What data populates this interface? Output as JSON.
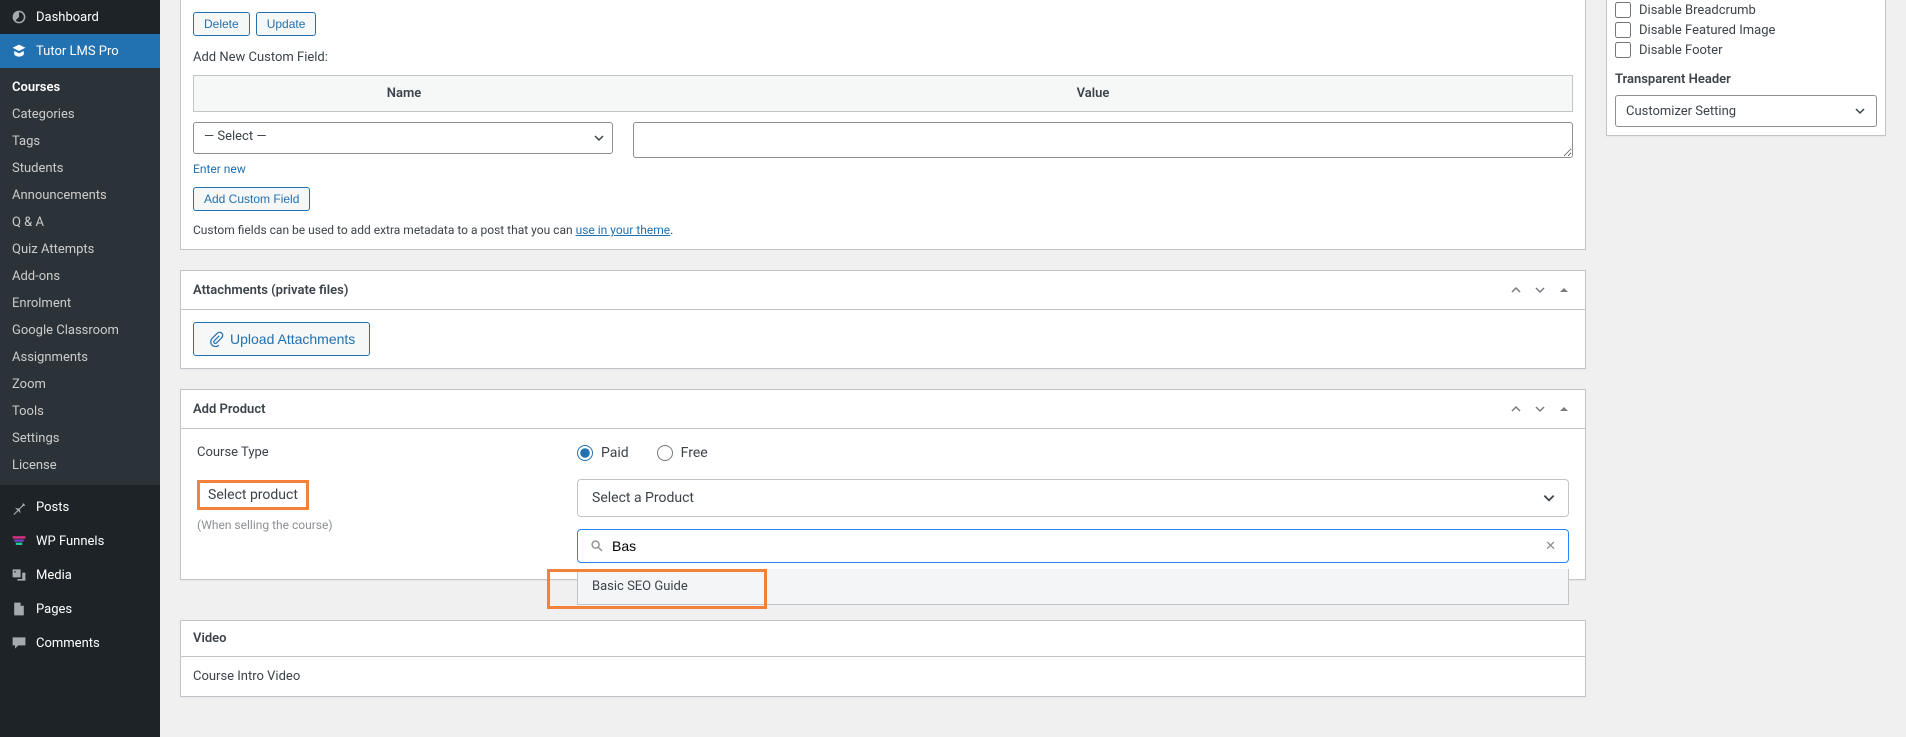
{
  "sidebar": {
    "top": [
      {
        "label": "Dashboard",
        "icon": "dashboard"
      },
      {
        "label": "Tutor LMS Pro",
        "icon": "tutor",
        "active": true
      }
    ],
    "sub": [
      {
        "label": "Courses",
        "current": true
      },
      {
        "label": "Categories"
      },
      {
        "label": "Tags"
      },
      {
        "label": "Students"
      },
      {
        "label": "Announcements"
      },
      {
        "label": "Q & A"
      },
      {
        "label": "Quiz Attempts"
      },
      {
        "label": "Add-ons"
      },
      {
        "label": "Enrolment"
      },
      {
        "label": "Google Classroom"
      },
      {
        "label": "Assignments"
      },
      {
        "label": "Zoom"
      },
      {
        "label": "Tools"
      },
      {
        "label": "Settings"
      },
      {
        "label": "License"
      }
    ],
    "bottom": [
      {
        "label": "Posts",
        "icon": "pin"
      },
      {
        "label": "WP Funnels",
        "icon": "funnel"
      },
      {
        "label": "Media",
        "icon": "media"
      },
      {
        "label": "Pages",
        "icon": "pages"
      },
      {
        "label": "Comments",
        "icon": "comments"
      }
    ]
  },
  "customFields": {
    "delete": "Delete",
    "update": "Update",
    "addNewLabel": "Add New Custom Field:",
    "nameHeader": "Name",
    "valueHeader": "Value",
    "selectPlaceholder": "— Select —",
    "enterNew": "Enter new",
    "addButton": "Add Custom Field",
    "footPrefix": "Custom fields can be used to add extra metadata to a post that you can ",
    "footLink": "use in your theme",
    "footSuffix": "."
  },
  "attachments": {
    "title": "Attachments (private files)",
    "upload": "Upload Attachments"
  },
  "addProduct": {
    "title": "Add Product",
    "courseTypeLabel": "Course Type",
    "paid": "Paid",
    "free": "Free",
    "selectProductHL": "Select product",
    "hint": "(When selling the course)",
    "selectPlaceholder": "Select a Product",
    "searchValue": "Bas",
    "resultItem": "Basic SEO Guide"
  },
  "video": {
    "title": "Video",
    "introLabel": "Course Intro Video"
  },
  "sidebox": {
    "disableBreadcrumb": "Disable Breadcrumb",
    "disableFeatured": "Disable Featured Image",
    "disableFooter": "Disable Footer",
    "transparentHeader": "Transparent Header",
    "customizerSetting": "Customizer Setting"
  }
}
